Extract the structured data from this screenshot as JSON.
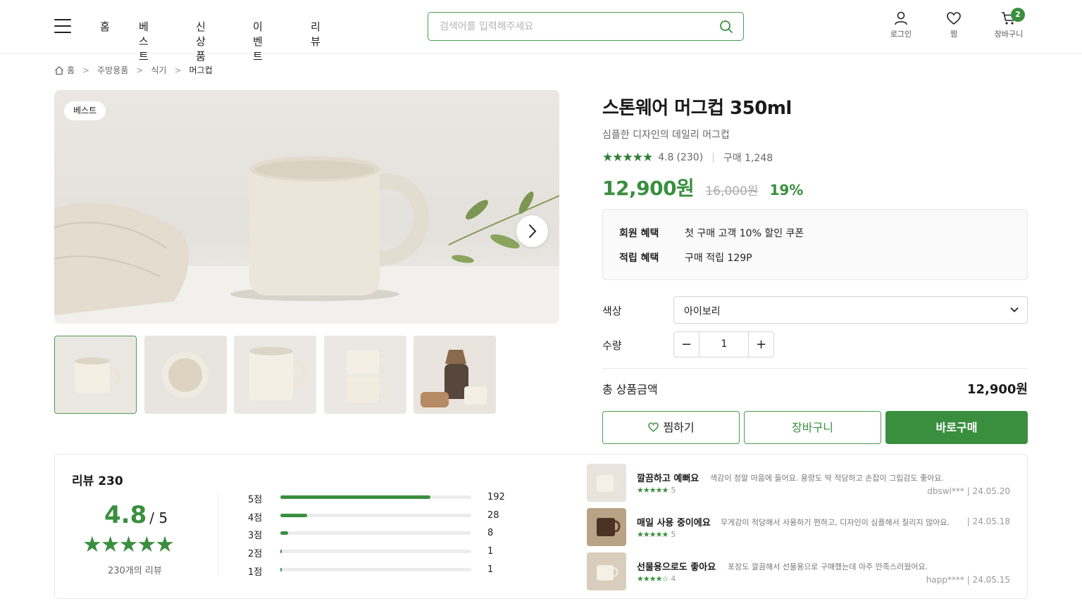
{
  "header": {
    "nav": [
      "홈",
      "베스트",
      "신상품",
      "이벤트",
      "리뷰"
    ],
    "search_placeholder": "검색어를 입력해주세요",
    "icons": [
      {
        "name": "user-icon",
        "label": "로그인"
      },
      {
        "name": "heart-icon",
        "label": "찜"
      },
      {
        "name": "cart-icon",
        "label": "장바구니"
      }
    ],
    "cart_count": "2"
  },
  "breadcrumb": [
    "홈",
    "주방용품",
    "식기",
    "머그컵"
  ],
  "gallery": {
    "badge": "베스트",
    "thumb_count": 5,
    "active_index": 0
  },
  "product": {
    "title": "스톤웨어 머그컵 350ml",
    "subtitle": "심플한 디자인의 데일리 머그컵",
    "rating": "4.8",
    "review_count_text": "(230)",
    "purchase_text": "구매 1,248",
    "price": "12,900원",
    "original_price": "16,000원",
    "discount": "19%"
  },
  "benefits": [
    {
      "label": "회원 혜택",
      "value": "첫 구매 고객 10% 할인 쿠폰"
    },
    {
      "label": "적립 혜택",
      "value": "구매 적립 129P"
    }
  ],
  "options": {
    "color_label": "색상",
    "color_value": "아이보리",
    "qty_label": "수량",
    "qty_value": "1",
    "minus": "−",
    "plus": "+"
  },
  "total": {
    "label": "총 상품금액",
    "value": "12,900원"
  },
  "buttons": {
    "wish": "찜하기",
    "cart": "장바구니",
    "buy": "바로구매"
  },
  "reviews": {
    "title": "리뷰 230",
    "score": "4.8",
    "out_of": "/ 5",
    "count_text": "230개의 리뷰",
    "distribution": [
      {
        "label": "5점",
        "count": "192",
        "ratio": 0.787
      },
      {
        "label": "4점",
        "count": "28",
        "ratio": 0.14
      },
      {
        "label": "3점",
        "count": "8",
        "ratio": 0.04
      },
      {
        "label": "2점",
        "count": "1",
        "ratio": 0.008
      },
      {
        "label": "1점",
        "count": "1",
        "ratio": 0.008
      }
    ],
    "items": [
      {
        "title": "깔끔하고 예뻐요",
        "text": "색감이 정말 마음에 들어요. 용량도 딱 적당하고 손잡이 그립감도 좋아요.",
        "stars": "★★★★★",
        "score": "5",
        "meta": "dbswl***  |  24.05.20"
      },
      {
        "title": "매일 사용 중이에요",
        "text": "무게감이 적당해서 사용하기 편하고, 디자인이 심플해서 질리지 않아요.",
        "stars": "★★★★★",
        "score": "5",
        "meta": "|  24.05.18"
      },
      {
        "title": "선물용으로도 좋아요",
        "text": "포장도 깔끔해서 선물용으로 구매했는데 아주 만족스러웠어요.",
        "stars": "★★★★☆",
        "score": "4",
        "meta": "happ****  |  24.05.15"
      }
    ]
  },
  "colors": {
    "accent": "#3a8f3f",
    "border": "#e6e6e6"
  }
}
